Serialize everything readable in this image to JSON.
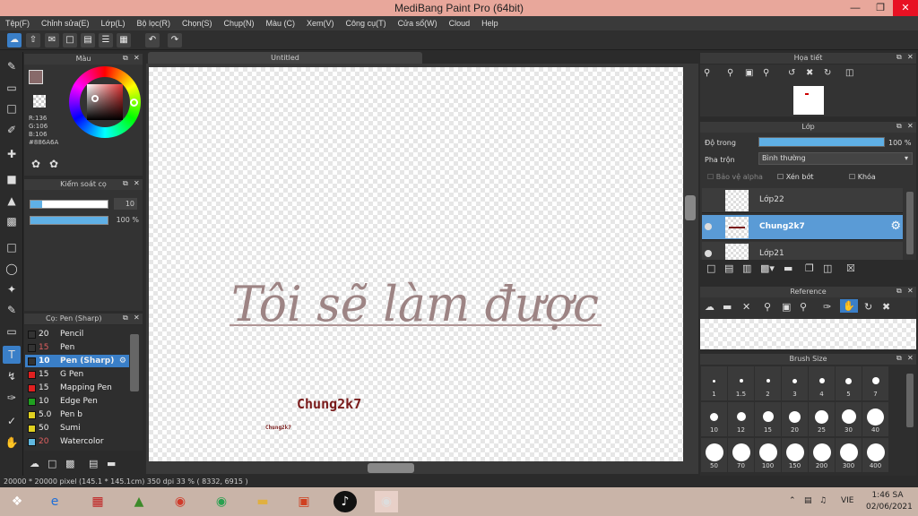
{
  "title": "MediBang Paint Pro (64bit)",
  "menu": [
    "Tệp(F)",
    "Chỉnh sửa(E)",
    "Lớp(L)",
    "Bộ lọc(R)",
    "Chọn(S)",
    "Chụp(N)",
    "Màu (C)",
    "Xem(V)",
    "Công cụ(T)",
    "Cửa sổ(W)",
    "Cloud",
    "Help"
  ],
  "color_panel": {
    "title": "Màu",
    "r": "R:136",
    "g": "G:106",
    "b": "B:106",
    "hex": "#886A6A",
    "primary": "#886a6a"
  },
  "brush_control": {
    "title": "Kiểm soát cọ",
    "size": "10",
    "opacity": "100 %",
    "size_level": 0.15,
    "opacity_level": 1.0
  },
  "brush_list": {
    "title": "Cọ: Pen (Sharp)",
    "items": [
      {
        "size": "20",
        "name": "Pencil",
        "color": "#333333",
        "size_color": "#eeeeee"
      },
      {
        "size": "15",
        "name": "Pen",
        "color": "#333333",
        "size_color": "#e06060"
      },
      {
        "size": "10",
        "name": "Pen (Sharp)",
        "color": "#333333",
        "size_color": "#ffffff",
        "selected": true
      },
      {
        "size": "15",
        "name": "G Pen",
        "color": "#e02020",
        "size_color": "#eeeeee"
      },
      {
        "size": "15",
        "name": "Mapping Pen",
        "color": "#e02020",
        "size_color": "#eeeeee"
      },
      {
        "size": "10",
        "name": "Edge Pen",
        "color": "#20a020",
        "size_color": "#eeeeee"
      },
      {
        "size": "5.0",
        "name": "Pen b",
        "color": "#e0d020",
        "size_color": "#eeeeee"
      },
      {
        "size": "50",
        "name": "Sumi",
        "color": "#e0d020",
        "size_color": "#eeeeee"
      },
      {
        "size": "20",
        "name": "Watercolor",
        "color": "#60b8e0",
        "size_color": "#e06060"
      }
    ]
  },
  "document_tab": "Untitled",
  "canvas_text": {
    "main": "Tôi sẽ làm được",
    "signature": "Chung2k7",
    "small_sig": "Chung2k7"
  },
  "navigator": {
    "title": "Họa tiết"
  },
  "layers": {
    "title": "Lớp",
    "opacity_label": "Độ trong",
    "opacity_value": "100 %",
    "opacity_level": 1.0,
    "blend_label": "Pha trộn",
    "blend_value": "Bình thường",
    "protect_alpha": "Bảo vệ alpha",
    "clipping": "Xén bớt",
    "lock": "Khóa",
    "items": [
      {
        "name": "Lớp22",
        "selected": false
      },
      {
        "name": "Chung2k7",
        "selected": true
      },
      {
        "name": "Lớp21",
        "selected": false
      }
    ]
  },
  "reference": {
    "title": "Reference"
  },
  "brush_size": {
    "title": "Brush Size",
    "sizes": [
      "1",
      "1.5",
      "2",
      "3",
      "4",
      "5",
      "7",
      "10",
      "12",
      "15",
      "20",
      "25",
      "30",
      "40",
      "50",
      "70",
      "100",
      "150",
      "200",
      "300",
      "400"
    ]
  },
  "status": "20000 * 20000 pixel   (145.1 * 145.1cm)   350 dpi   33 %   ( 8332, 6915 )",
  "taskbar": {
    "lang": "VIE",
    "time": "1:46 SA",
    "date": "02/06/2021"
  }
}
